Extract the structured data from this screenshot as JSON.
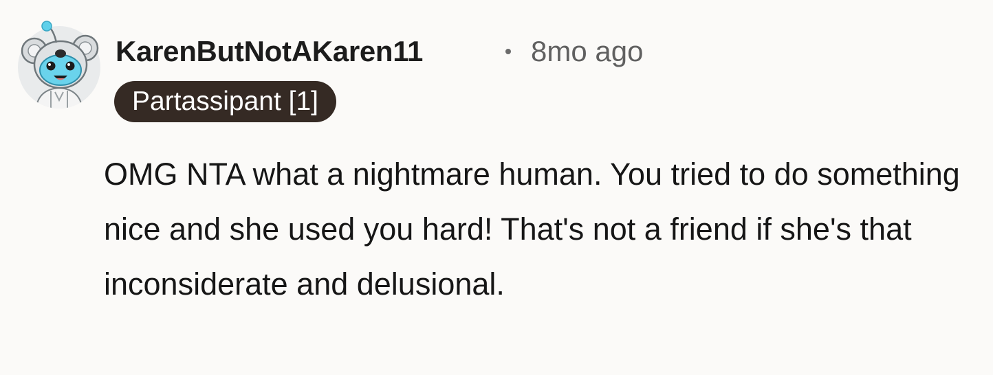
{
  "comment": {
    "author": "KarenButNotAKaren11",
    "separator": "•",
    "timestamp": "8mo ago",
    "flair": "Partassipant [1]",
    "body": "OMG NTA what a nightmare human. You tried to do something nice and she used you hard! That's not a friend if she's that inconsiderate and delusional.",
    "avatar_icon": "snoo-koala-avatar-icon"
  },
  "colors": {
    "background": "#fbfaf8",
    "flair_bg": "#352a24",
    "flair_text": "#ffffff",
    "author": "#1c1c1c",
    "meta": "#606060",
    "avatar_accent": "#5fd0ea"
  }
}
